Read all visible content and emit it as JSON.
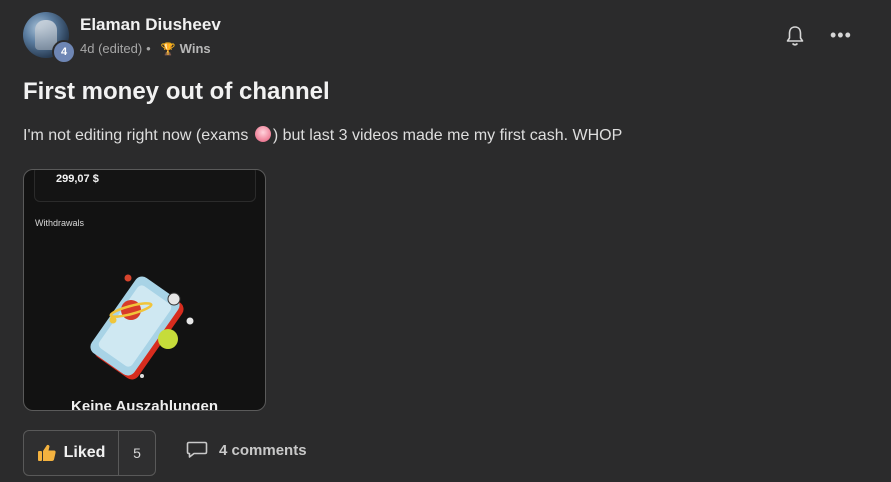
{
  "post": {
    "author": {
      "name": "Elaman Diusheev",
      "level": "4"
    },
    "meta": {
      "time": "4d (edited)",
      "separator": "•",
      "category": "Wins"
    },
    "title": "First money out of channel",
    "body_before_emoji": "I'm not editing right now (exams ",
    "body_after_emoji": ") but last 3 videos made me my first cash. WHOP",
    "attachment": {
      "amount": "299,07 $",
      "section_label": "Withdrawals",
      "empty_text": "Keine Auszahlungen"
    }
  },
  "actions": {
    "like_label": "Liked",
    "like_count": "5",
    "comments_label": "4 comments"
  },
  "icons": {
    "bell": "bell-icon",
    "more": "more-icon",
    "trophy": "trophy-icon",
    "thumbs_up": "thumbs-up-icon",
    "comment": "comment-icon",
    "emoji": "anxious-face-emoji"
  },
  "colors": {
    "background": "#2b2b2c",
    "badge": "#6e86b4",
    "trophy": "#d29b2e"
  }
}
